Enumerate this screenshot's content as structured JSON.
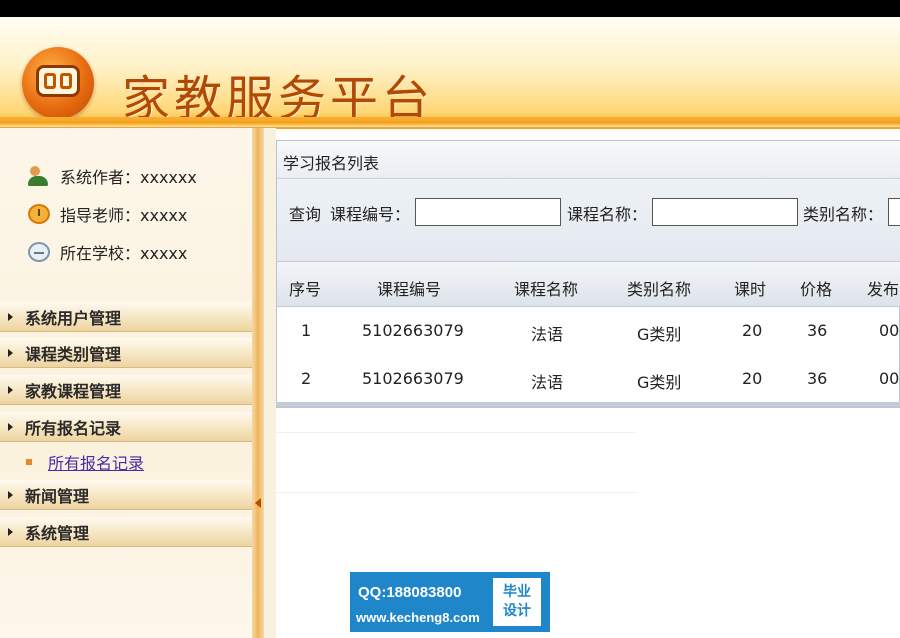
{
  "header": {
    "title": "家教服务平台"
  },
  "sidebar": {
    "info": [
      {
        "label": "系统作者：xxxxxx",
        "icon": "user-icon"
      },
      {
        "label": "指导老师：xxxxx",
        "icon": "alarm-clock-icon"
      },
      {
        "label": "所在学校：xxxxx",
        "icon": "school-icon"
      }
    ],
    "menu": [
      {
        "label": "系统用户管理"
      },
      {
        "label": "课程类别管理"
      },
      {
        "label": "家教课程管理"
      },
      {
        "label": "所有报名记录"
      },
      {
        "label": "新闻管理"
      },
      {
        "label": "系统管理"
      }
    ],
    "submenu": {
      "label": "所有报名记录"
    }
  },
  "panel": {
    "title": "学习报名列表",
    "search": {
      "prefix": "查询",
      "course_code_label": "课程编号：",
      "course_code_value": "",
      "course_name_label": "课程名称：",
      "course_name_value": "",
      "category_label": "类别名称：",
      "category_value": ""
    },
    "table": {
      "headers": [
        "序号",
        "课程编号",
        "课程名称",
        "类别名称",
        "课时",
        "价格",
        "发布"
      ],
      "rows": [
        [
          "1",
          "5102663079",
          "法语",
          "G类别",
          "20",
          "36",
          "00"
        ],
        [
          "2",
          "5102663079",
          "法语",
          "G类别",
          "20",
          "36",
          "00."
        ]
      ]
    }
  },
  "watermark": {
    "qq": "QQ:188083800",
    "site": "www.kecheng8.com",
    "badge_line1": "毕业",
    "badge_line2": "设计"
  },
  "colors": {
    "header_gradient_end": "#f0a21e",
    "title_text": "#b24a05",
    "menu_bg": "#f6e6c3",
    "link": "#4a2aa8",
    "watermark_bg": "#1f86c9"
  }
}
